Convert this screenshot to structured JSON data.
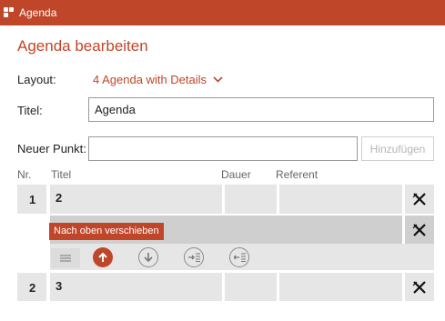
{
  "window": {
    "title": "Agenda",
    "accent_color": "#c0462a"
  },
  "page": {
    "heading": "Agenda bearbeiten"
  },
  "form": {
    "layout_label": "Layout:",
    "layout_value": "4 Agenda with Details",
    "title_label": "Titel:",
    "title_value": "Agenda",
    "new_item_label": "Neuer Punkt:",
    "new_item_value": "",
    "add_button": "Hinzufügen"
  },
  "table": {
    "columns": [
      "Nr.",
      "Titel",
      "Dauer",
      "Referent"
    ],
    "rows": [
      {
        "nr": "1",
        "title": "2",
        "duration": "",
        "presenter": ""
      },
      {
        "nr": "",
        "title": "",
        "duration": "",
        "presenter": ""
      },
      {
        "nr": "2",
        "title": "3",
        "duration": "",
        "presenter": ""
      }
    ]
  },
  "row_toolbar": {
    "tooltip": "Nach oben verschieben",
    "icons": [
      "drag-handle-icon",
      "arrow-up-icon",
      "arrow-down-icon",
      "indent-icon",
      "outdent-icon",
      "delete-x-icon"
    ]
  }
}
